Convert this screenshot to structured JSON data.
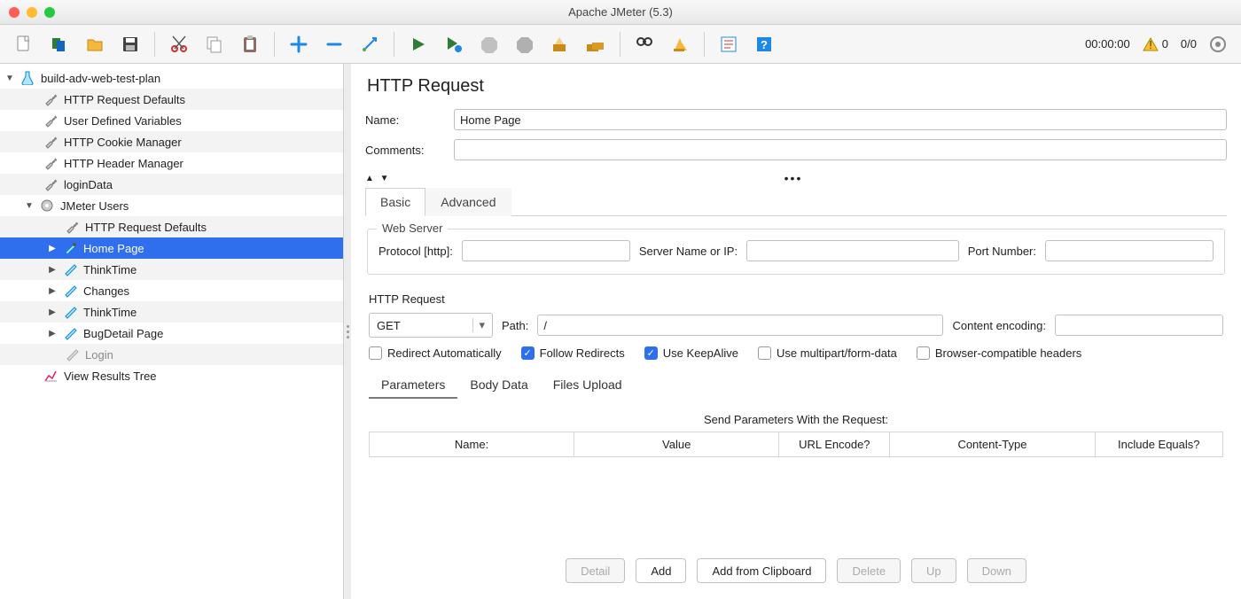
{
  "window": {
    "title": "Apache JMeter (5.3)"
  },
  "status": {
    "timer": "00:00:00",
    "warn_count": "0",
    "thread_counter": "0/0"
  },
  "tree": {
    "root": "build-adv-web-test-plan",
    "l1": [
      "HTTP Request Defaults",
      "User Defined Variables",
      "HTTP Cookie Manager",
      "HTTP Header Manager",
      "loginData"
    ],
    "tg": "JMeter Users",
    "tg_children": [
      "HTTP Request Defaults",
      "Home Page",
      "ThinkTime",
      "Changes",
      "ThinkTime",
      "BugDetail Page",
      "Login"
    ],
    "results": "View Results Tree"
  },
  "panel": {
    "title": "HTTP Request",
    "name_label": "Name:",
    "name_value": "Home Page",
    "comments_label": "Comments:",
    "comments_value": "",
    "tabs": {
      "basic": "Basic",
      "advanced": "Advanced"
    },
    "web_server": {
      "legend": "Web Server",
      "protocol_label": "Protocol [http]:",
      "protocol_value": "",
      "server_label": "Server Name or IP:",
      "server_value": "",
      "port_label": "Port Number:",
      "port_value": ""
    },
    "http_req": {
      "legend": "HTTP Request",
      "method": "GET",
      "path_label": "Path:",
      "path_value": "/",
      "enc_label": "Content encoding:",
      "enc_value": ""
    },
    "checks": {
      "redirect_auto": "Redirect Automatically",
      "follow": "Follow Redirects",
      "keepalive": "Use KeepAlive",
      "multipart": "Use multipart/form-data",
      "browser": "Browser-compatible headers"
    },
    "subtabs": {
      "params": "Parameters",
      "body": "Body Data",
      "files": "Files Upload"
    },
    "params_header": "Send Parameters With the Request:",
    "cols": {
      "name": "Name:",
      "value": "Value",
      "url": "URL Encode?",
      "ctype": "Content-Type",
      "inc": "Include Equals?"
    },
    "buttons": {
      "detail": "Detail",
      "add": "Add",
      "clip": "Add from Clipboard",
      "delete": "Delete",
      "up": "Up",
      "down": "Down"
    }
  }
}
